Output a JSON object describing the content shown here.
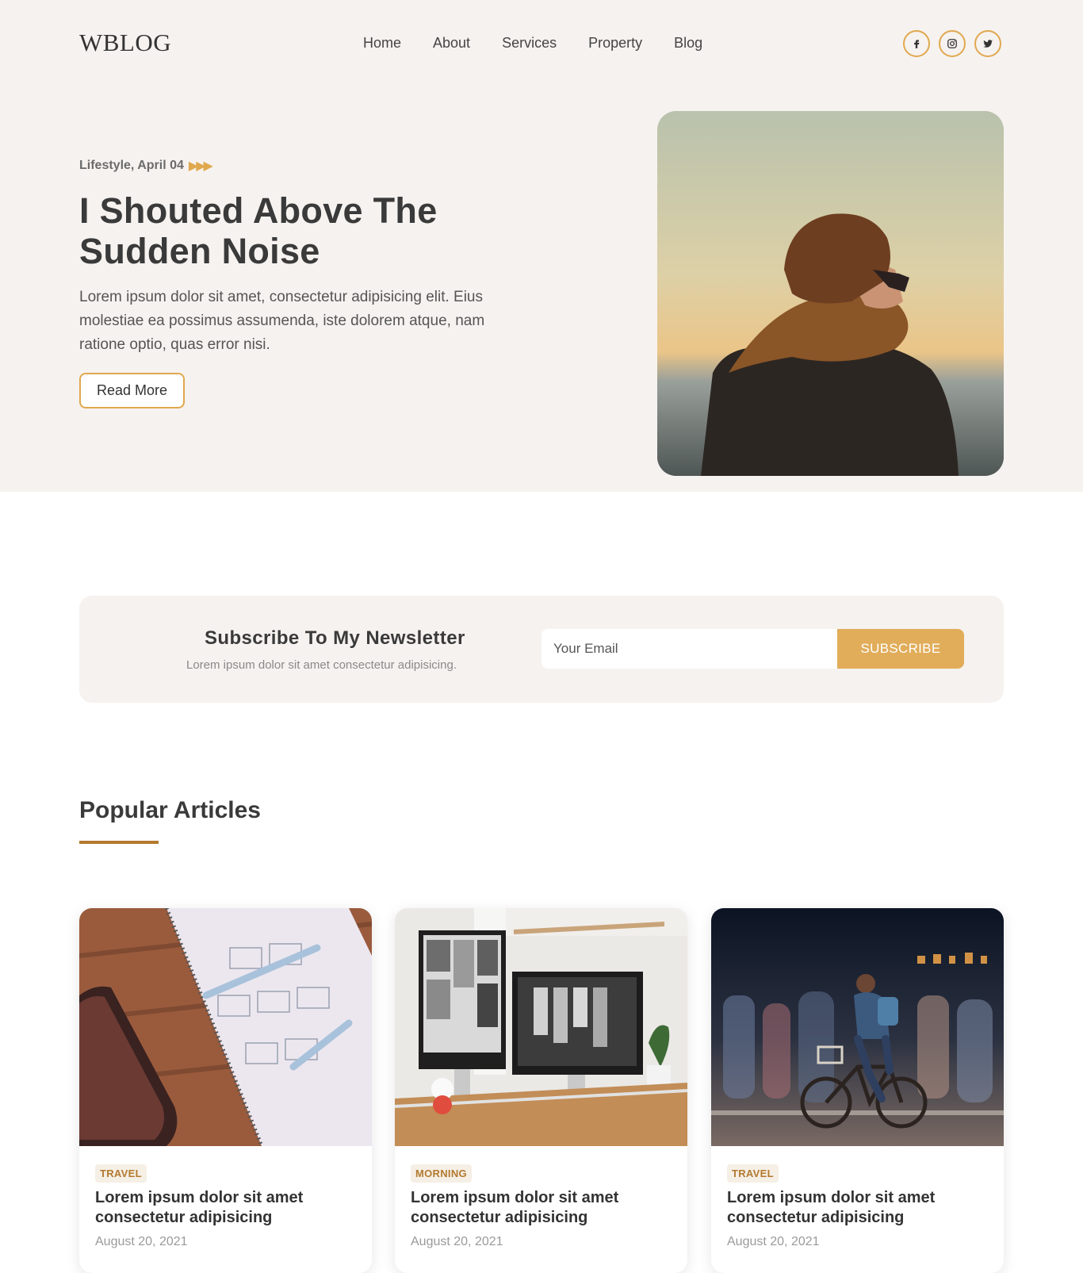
{
  "header": {
    "logo": "WBLOG",
    "nav": [
      "Home",
      "About",
      "Services",
      "Property",
      "Blog"
    ],
    "socials": [
      {
        "name": "facebook-icon"
      },
      {
        "name": "instagram-icon"
      },
      {
        "name": "twitter-icon"
      }
    ]
  },
  "hero": {
    "meta": "Lifestyle, April 04",
    "title": "I Shouted Above The Sudden Noise",
    "text": "Lorem ipsum dolor sit amet, consectetur adipisicing elit. Eius molestiae ea possimus assumenda, iste dolorem atque, nam ratione optio, quas error nisi.",
    "button": "Read More"
  },
  "newsletter": {
    "title": "Subscribe To My Newsletter",
    "subtitle": "Lorem ipsum dolor sit amet consectetur adipisicing.",
    "placeholder": "Your Email",
    "button": "SUBSCRIBE"
  },
  "popular": {
    "title": "Popular Articles",
    "cards": [
      {
        "tag": "TRAVEL",
        "title": "Lorem ipsum dolor sit amet consectetur adipisicing",
        "date": "August 20, 2021"
      },
      {
        "tag": "MORNING",
        "title": "Lorem ipsum dolor sit amet consectetur adipisicing",
        "date": "August 20, 2021"
      },
      {
        "tag": "TRAVEL",
        "title": "Lorem ipsum dolor sit amet consectetur adipisicing",
        "date": "August 20, 2021"
      }
    ]
  },
  "colors": {
    "accent": "#e0a84f",
    "accent_dark": "#b37a2f",
    "hero_bg": "#f6f2ef",
    "text": "#3a3a3a"
  }
}
